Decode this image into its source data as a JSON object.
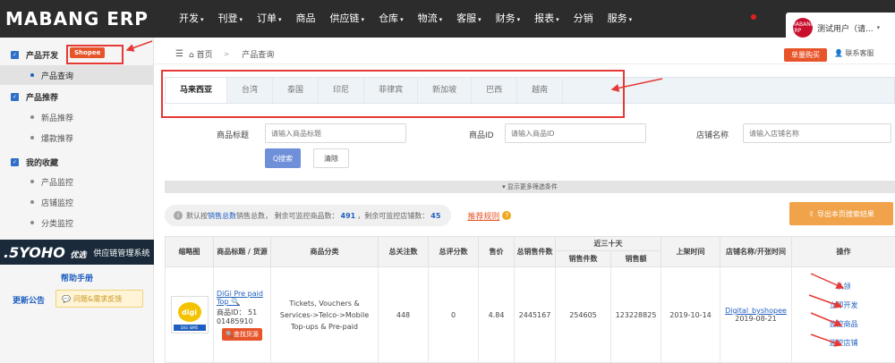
{
  "header": {
    "logo": "MABANG ERP",
    "nav": [
      {
        "label": "开发",
        "caret": true
      },
      {
        "label": "刊登",
        "caret": true
      },
      {
        "label": "订单",
        "caret": true
      },
      {
        "label": "商品",
        "caret": false
      },
      {
        "label": "供应链",
        "caret": true
      },
      {
        "label": "仓库",
        "caret": true
      },
      {
        "label": "物流",
        "caret": true
      },
      {
        "label": "客服",
        "caret": true
      },
      {
        "label": "财务",
        "caret": true
      },
      {
        "label": "报表",
        "caret": true
      },
      {
        "label": "分销",
        "caret": false
      },
      {
        "label": "服务",
        "caret": true
      }
    ],
    "avatar_text": "MABANG ERP",
    "user": "测试用户（请...",
    "colors": {
      "bar": "#2c2c2c",
      "accent": "#e8542a",
      "link": "#1f5fbf",
      "annotation": "#e53935"
    }
  },
  "sidebar": {
    "groups": [
      {
        "label": "产品开发",
        "items": [
          "产品查询"
        ]
      },
      {
        "label": "产品推荐",
        "items": [
          "新品推荐",
          "爆款推荐"
        ]
      },
      {
        "label": "我的收藏",
        "items": [
          "产品监控",
          "店铺监控",
          "分类监控"
        ]
      }
    ],
    "shopee_tag": "Shopee",
    "yoho_logo": ".5YOHO",
    "yoho_small": "优选",
    "yoho_text": "供应链管理系统",
    "help": "帮助手册",
    "announce": "更新公告",
    "feedback": "问题&需求反馈"
  },
  "breadcrumb": {
    "home": "首页",
    "sep": ">",
    "current": "产品查询",
    "buy": "单量购买",
    "service": "联系客服"
  },
  "country_tabs": [
    "马来西亚",
    "台湾",
    "泰国",
    "印尼",
    "菲律宾",
    "新加坡",
    "巴西",
    "越南"
  ],
  "filters": {
    "title_label": "商品标题",
    "title_placeholder": "请输入商品标题",
    "id_label": "商品ID",
    "id_placeholder": "请输入商品ID",
    "shop_label": "店铺名称",
    "shop_placeholder": "请输入店铺名称",
    "search": "Q搜索",
    "reset": "清除",
    "more": "▾ 显示更多筛选条件"
  },
  "info": {
    "prefix": "默认按",
    "sort_link": "销售总数",
    "mid": "销售总数， 剩余可监控商品数：",
    "products_left": "491",
    "mid2": "，剩余可监控店铺数：",
    "shops_left": "45",
    "rule": "推荐规则",
    "export": "导出本页搜索结果"
  },
  "table": {
    "headers": {
      "thumb": "缩略图",
      "title": "商品标题 / 货源",
      "category": "商品分类",
      "watch": "总关注数",
      "rating": "总评分数",
      "price": "售价",
      "total_sales": "总销售件数",
      "recent": "近三十天",
      "recent_qty": "销售件数",
      "recent_amt": "销售额",
      "listed": "上架时间",
      "shop": "店铺名称/开张时间",
      "ops": "操作"
    },
    "rows": [
      {
        "thumb_logo": "digi",
        "thumb_bar": "DiGi SIM5",
        "title": "DiGi Pre paid Top",
        "id_line": "商品ID： 51 01485910",
        "find": "查找货源",
        "category": "Tickets, Vouchers & Services->Telco->Mobile Top-ups & Pre-paid",
        "watch": "448",
        "rating": "0",
        "price": "4.84",
        "total_sales": "2445167",
        "recent_qty": "254605",
        "recent_amt": "123228825",
        "listed": "2019-10-14",
        "shop": "Digital_byshopee",
        "shop_date": "2019-08-21",
        "ops": [
          "认领",
          "立即开发",
          "监控商品",
          "监控店铺"
        ]
      }
    ]
  }
}
